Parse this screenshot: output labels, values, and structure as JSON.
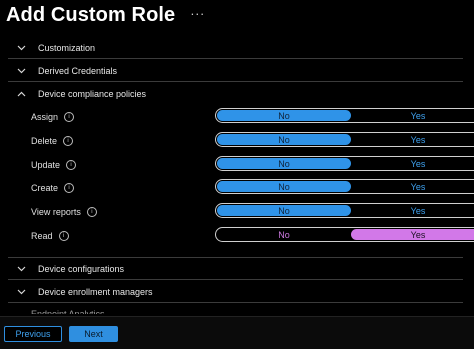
{
  "page": {
    "title": "Add Custom Role",
    "more_glyph": "···"
  },
  "sections": {
    "customization": "Customization",
    "derived_credentials": "Derived Credentials",
    "device_compliance": "Device compliance policies",
    "device_configurations": "Device configurations",
    "device_enrollment": "Device enrollment managers",
    "endpoint_analytics_partial": "Endpoint Analytics"
  },
  "permissions": [
    {
      "label": "Assign",
      "no": "No",
      "yes": "Yes",
      "selected": "No"
    },
    {
      "label": "Delete",
      "no": "No",
      "yes": "Yes",
      "selected": "No"
    },
    {
      "label": "Update",
      "no": "No",
      "yes": "Yes",
      "selected": "No"
    },
    {
      "label": "Create",
      "no": "No",
      "yes": "Yes",
      "selected": "No"
    },
    {
      "label": "View reports",
      "no": "No",
      "yes": "Yes",
      "selected": "No"
    },
    {
      "label": "Read",
      "no": "No",
      "yes": "Yes",
      "selected": "Yes"
    }
  ],
  "info_glyph": "i",
  "footer": {
    "previous": "Previous",
    "next": "Next"
  },
  "colors": {
    "accent": "#2f8fe0",
    "selected_read": "#d278e8",
    "background": "#000000"
  }
}
